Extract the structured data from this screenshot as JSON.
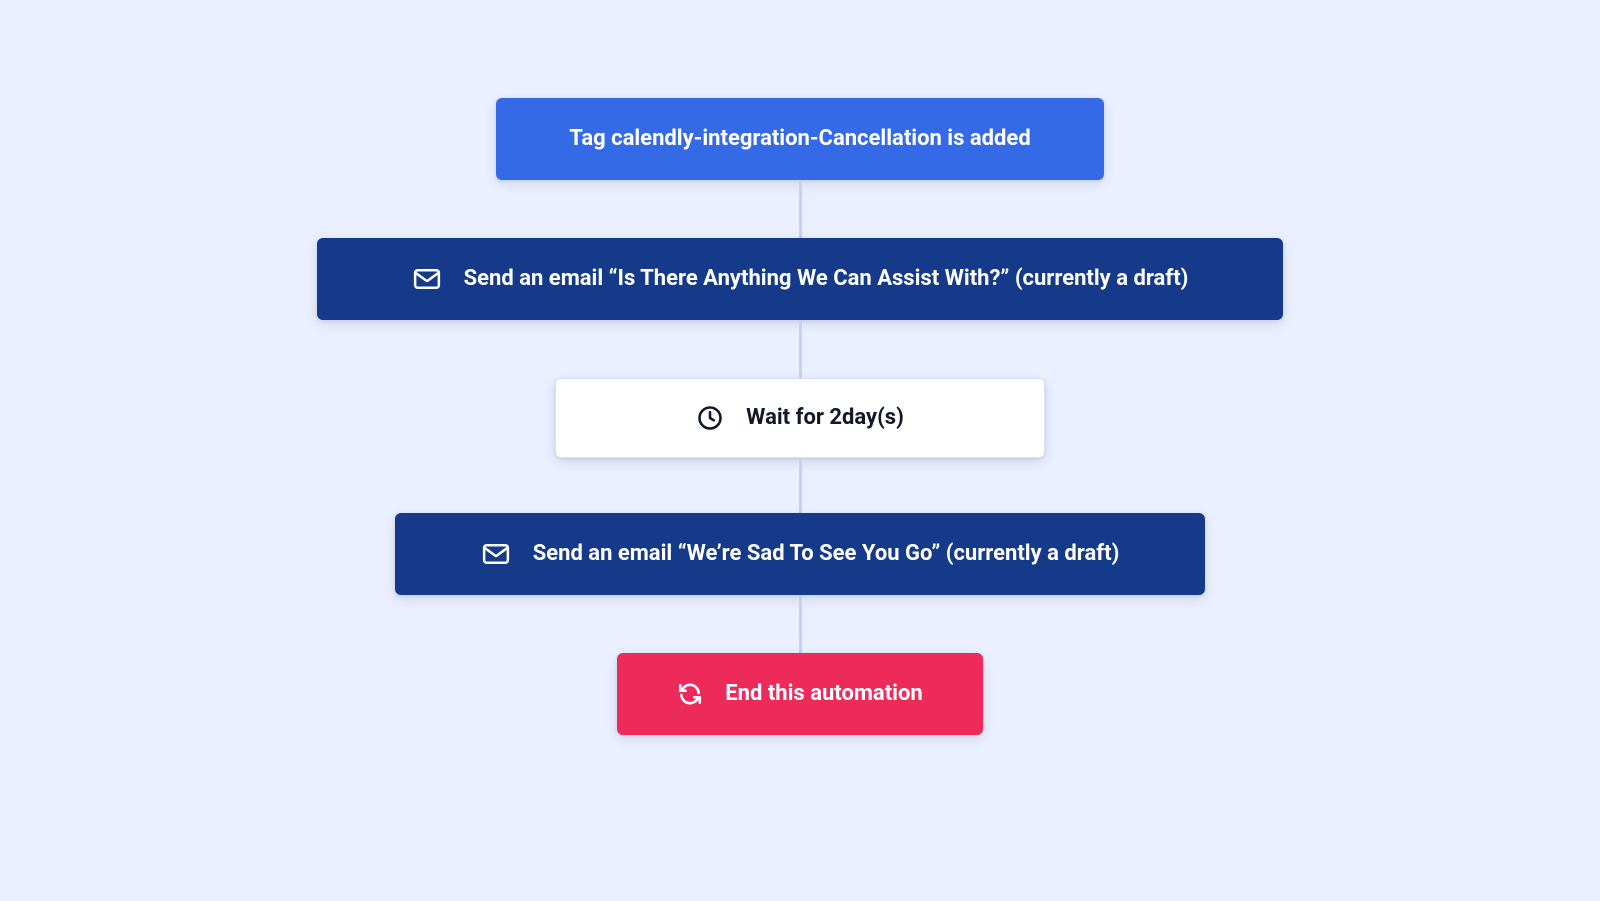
{
  "flow": {
    "trigger": {
      "label": "Tag calendly-integration-Cancellation is added"
    },
    "steps": [
      {
        "kind": "action",
        "icon": "envelope",
        "label": "Send an email “Is There Anything We Can Assist With?” (currently a draft)"
      },
      {
        "kind": "wait",
        "icon": "clock",
        "label": "Wait for 2day(s)"
      },
      {
        "kind": "action",
        "icon": "envelope",
        "label": "Send an email “We’re Sad To See You Go” (currently a draft)"
      },
      {
        "kind": "end",
        "icon": "refresh",
        "label": "End this automation"
      }
    ]
  },
  "colors": {
    "background": "#eaf0ff",
    "trigger": "#356ae6",
    "action": "#153a8a",
    "wait_bg": "#ffffff",
    "wait_border": "#d9e0ef",
    "end": "#ed2b5b",
    "connector": "#c1d2f5"
  }
}
